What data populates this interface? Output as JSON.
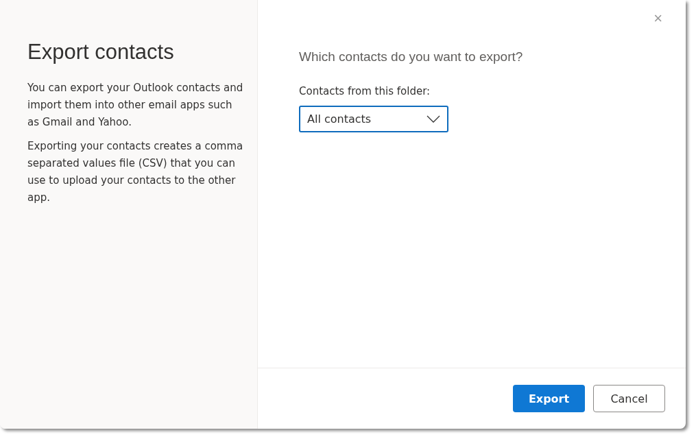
{
  "sidebar": {
    "title": "Export contacts",
    "paragraphs": [
      "You can export your Outlook contacts and import them into other email apps such as Gmail and Yahoo.",
      "Exporting your contacts creates a comma separated values file (CSV) that you can use to upload your contacts to the other app."
    ]
  },
  "close_button": {
    "label": "×"
  },
  "main": {
    "question": "Which contacts do you want to export?",
    "folder_label": "Contacts from this folder:",
    "folder_dropdown": {
      "value": "All contacts"
    }
  },
  "buttons": [
    {
      "label": "Export",
      "kind": "primary"
    },
    {
      "label": "Cancel",
      "kind": "secondary"
    }
  ]
}
